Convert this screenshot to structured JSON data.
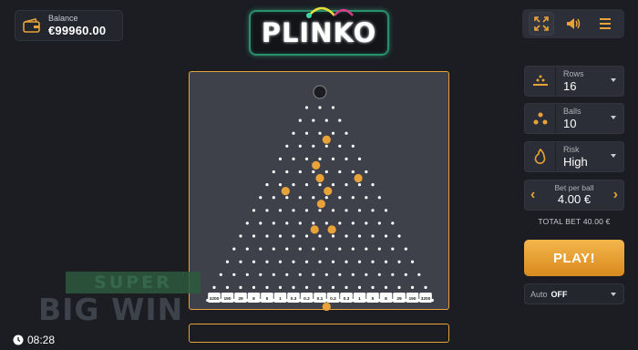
{
  "balance": {
    "label": "Balance",
    "value": "€99960.00",
    "icon": "wallet-icon"
  },
  "logo": {
    "text": "PLINKO"
  },
  "top_controls": [
    {
      "name": "fullscreen-icon"
    },
    {
      "name": "sound-icon"
    },
    {
      "name": "menu-icon"
    }
  ],
  "settings": {
    "rows": {
      "label": "Rows",
      "value": "16"
    },
    "balls": {
      "label": "Balls",
      "value": "10"
    },
    "risk": {
      "label": "Risk",
      "value": "High"
    }
  },
  "bet": {
    "label": "Bet per ball",
    "value": "4.00 €"
  },
  "total_bet": "TOTAL BET 40.00 €",
  "play_label": "PLAY!",
  "auto": {
    "label": "Auto",
    "value": "OFF"
  },
  "board": {
    "rows": 16,
    "multipliers": [
      "3200",
      "190",
      "29",
      "8",
      "5",
      "1",
      "0.3",
      "0.2",
      "0.1",
      "0.2",
      "0.3",
      "1",
      "5",
      "8",
      "29",
      "190",
      "3200"
    ],
    "balls_in_flight": [
      {
        "row": 2,
        "offset": 0.5
      },
      {
        "row": 4,
        "offset": -0.3
      },
      {
        "row": 5,
        "offset": 0.0
      },
      {
        "row": 6,
        "offset": -2.6
      },
      {
        "row": 6,
        "offset": 0.6
      },
      {
        "row": 5,
        "offset": 2.9
      },
      {
        "row": 7,
        "offset": 0.1
      },
      {
        "row": 9,
        "offset": -0.4
      },
      {
        "row": 9,
        "offset": 0.9
      },
      {
        "row": 15,
        "offset": 0.5
      }
    ],
    "colors": {
      "peg": "#ffffff",
      "ball": "#e8a23a",
      "frame": "#e8a23a"
    }
  },
  "watermark": {
    "line1": "SUPER",
    "line2": "BIG WIN"
  },
  "clock": "08:28"
}
